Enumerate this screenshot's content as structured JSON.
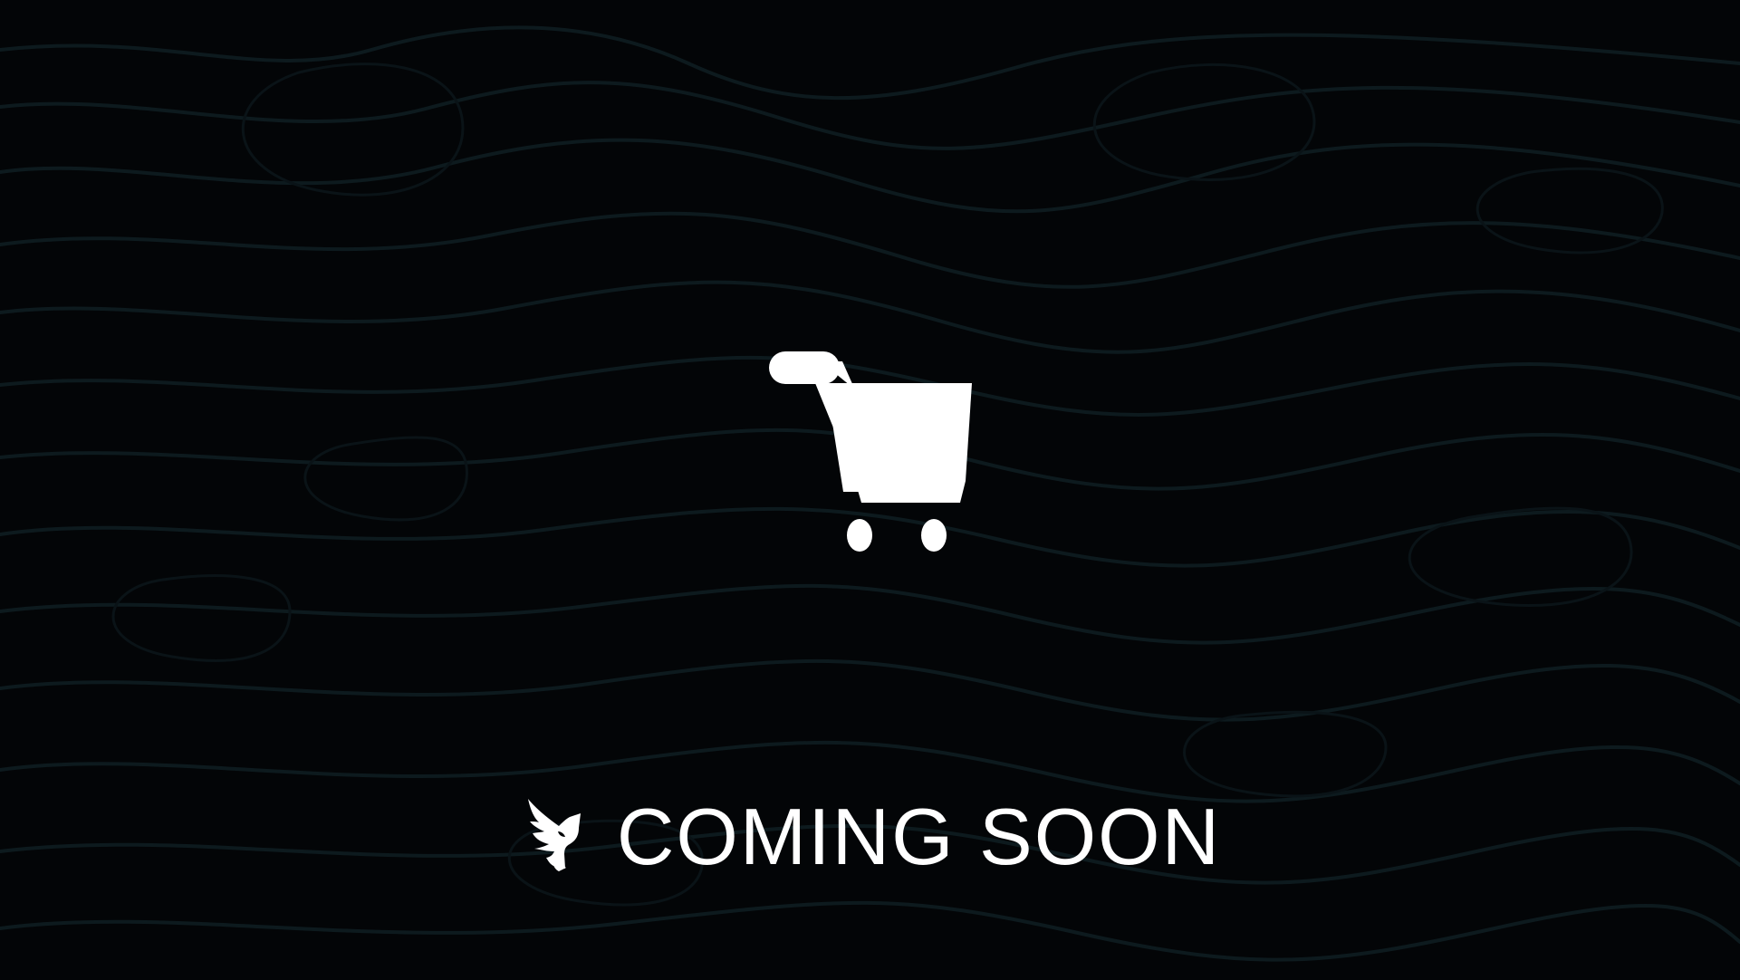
{
  "page": {
    "background_color": "#030507",
    "line_color": "#0d1a1e"
  },
  "hero": {
    "icon": "shopping-cart-icon",
    "icon_color": "#ffffff"
  },
  "coming_soon": {
    "logo": "eagle-logo",
    "label": "COMING SOON",
    "text_color": "#ffffff"
  }
}
